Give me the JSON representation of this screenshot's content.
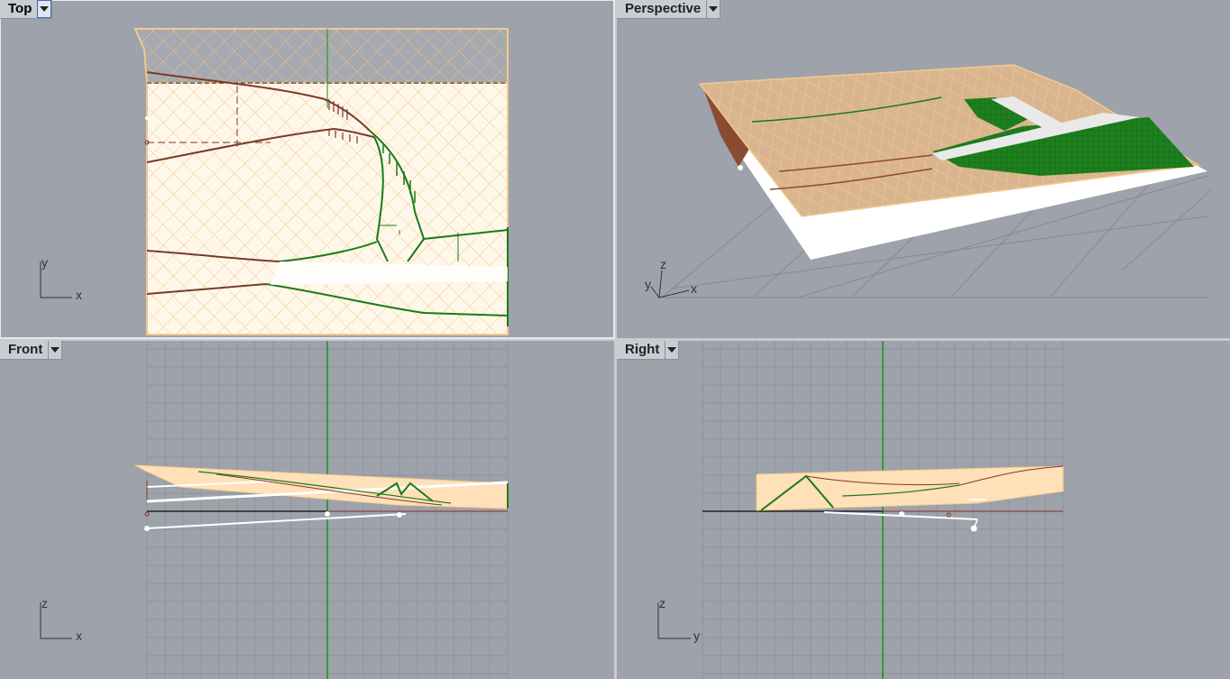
{
  "viewports": {
    "top": {
      "label": "Top",
      "axis_h": "x",
      "axis_v": "y"
    },
    "persp": {
      "label": "Perspective",
      "axis_h": "x",
      "axis_v": "z",
      "axis_d": "y"
    },
    "front": {
      "label": "Front",
      "axis_h": "x",
      "axis_v": "z"
    },
    "right": {
      "label": "Right",
      "axis_h": "y",
      "axis_v": "z"
    }
  },
  "icons": {
    "menu": "dropdown-arrow-icon",
    "axes": "axes-gizmo-icon"
  },
  "colors": {
    "viewport_bg": "#9ea2aa",
    "grid": "#8e9299",
    "surface": "#ffe6c2",
    "surface_edge": "#f2c98e",
    "mesh": "#f0c282",
    "green": "#1a7a1a",
    "brown": "#7a3a28",
    "white": "#ffffff",
    "axis_green": "#169416",
    "axis_red": "#8c2a2a"
  }
}
